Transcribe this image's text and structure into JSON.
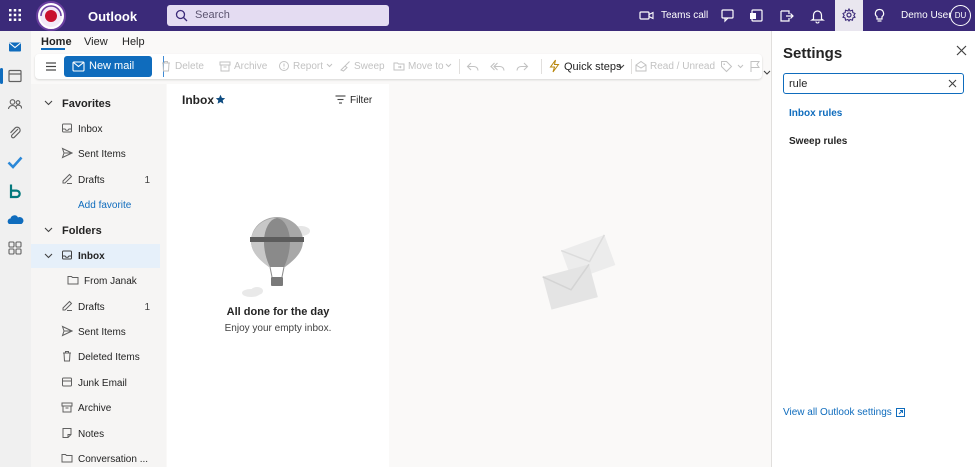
{
  "app": {
    "title": "Outlook"
  },
  "search": {
    "placeholder": "Search"
  },
  "topbar": {
    "teams_call": "Teams call",
    "user_name": "Demo User",
    "user_initials": "DU"
  },
  "ribbon": {
    "tabs": [
      "Home",
      "View",
      "Help"
    ],
    "new_mail": "New mail",
    "commands": [
      "Delete",
      "Archive",
      "Report",
      "Sweep",
      "Move to"
    ],
    "quick_steps": "Quick steps",
    "read_unread": "Read / Unread"
  },
  "folders": {
    "favorites_header": "Favorites",
    "favorites": [
      {
        "label": "Inbox",
        "icon": "inbox-icon",
        "count": ""
      },
      {
        "label": "Sent Items",
        "icon": "send-icon",
        "count": ""
      },
      {
        "label": "Drafts",
        "icon": "draft-icon",
        "count": "1"
      }
    ],
    "add_favorite": "Add favorite",
    "folders_header": "Folders",
    "inbox": "Inbox",
    "subfolder": "From Janak",
    "items": [
      {
        "label": "Drafts",
        "icon": "draft-icon",
        "count": "1"
      },
      {
        "label": "Sent Items",
        "icon": "send-icon",
        "count": ""
      },
      {
        "label": "Deleted Items",
        "icon": "trash-icon",
        "count": ""
      },
      {
        "label": "Junk Email",
        "icon": "junk-icon",
        "count": ""
      },
      {
        "label": "Archive",
        "icon": "archive-icon",
        "count": ""
      },
      {
        "label": "Notes",
        "icon": "notes-icon",
        "count": ""
      },
      {
        "label": "Conversation ...",
        "icon": "folder-icon",
        "count": ""
      }
    ]
  },
  "message_list": {
    "title": "Inbox",
    "filter": "Filter",
    "empty_title": "All done for the day",
    "empty_subtitle": "Enjoy your empty inbox."
  },
  "settings": {
    "title": "Settings",
    "search_value": "rule",
    "results": [
      "Inbox rules",
      "Sweep rules"
    ],
    "view_all": "View all Outlook settings"
  },
  "colors": {
    "brand": "#3b2a79",
    "accent": "#0f6cbd"
  }
}
